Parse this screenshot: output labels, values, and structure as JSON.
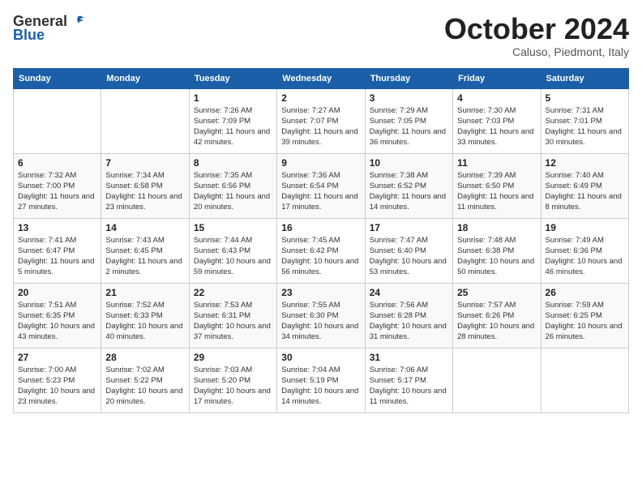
{
  "header": {
    "logo_general": "General",
    "logo_blue": "Blue",
    "month_title": "October 2024",
    "subtitle": "Caluso, Piedmont, Italy"
  },
  "weekdays": [
    "Sunday",
    "Monday",
    "Tuesday",
    "Wednesday",
    "Thursday",
    "Friday",
    "Saturday"
  ],
  "weeks": [
    [
      {
        "day": "",
        "info": ""
      },
      {
        "day": "",
        "info": ""
      },
      {
        "day": "1",
        "info": "Sunrise: 7:26 AM\nSunset: 7:09 PM\nDaylight: 11 hours and 42 minutes."
      },
      {
        "day": "2",
        "info": "Sunrise: 7:27 AM\nSunset: 7:07 PM\nDaylight: 11 hours and 39 minutes."
      },
      {
        "day": "3",
        "info": "Sunrise: 7:29 AM\nSunset: 7:05 PM\nDaylight: 11 hours and 36 minutes."
      },
      {
        "day": "4",
        "info": "Sunrise: 7:30 AM\nSunset: 7:03 PM\nDaylight: 11 hours and 33 minutes."
      },
      {
        "day": "5",
        "info": "Sunrise: 7:31 AM\nSunset: 7:01 PM\nDaylight: 11 hours and 30 minutes."
      }
    ],
    [
      {
        "day": "6",
        "info": "Sunrise: 7:32 AM\nSunset: 7:00 PM\nDaylight: 11 hours and 27 minutes."
      },
      {
        "day": "7",
        "info": "Sunrise: 7:34 AM\nSunset: 6:58 PM\nDaylight: 11 hours and 23 minutes."
      },
      {
        "day": "8",
        "info": "Sunrise: 7:35 AM\nSunset: 6:56 PM\nDaylight: 11 hours and 20 minutes."
      },
      {
        "day": "9",
        "info": "Sunrise: 7:36 AM\nSunset: 6:54 PM\nDaylight: 11 hours and 17 minutes."
      },
      {
        "day": "10",
        "info": "Sunrise: 7:38 AM\nSunset: 6:52 PM\nDaylight: 11 hours and 14 minutes."
      },
      {
        "day": "11",
        "info": "Sunrise: 7:39 AM\nSunset: 6:50 PM\nDaylight: 11 hours and 11 minutes."
      },
      {
        "day": "12",
        "info": "Sunrise: 7:40 AM\nSunset: 6:49 PM\nDaylight: 11 hours and 8 minutes."
      }
    ],
    [
      {
        "day": "13",
        "info": "Sunrise: 7:41 AM\nSunset: 6:47 PM\nDaylight: 11 hours and 5 minutes."
      },
      {
        "day": "14",
        "info": "Sunrise: 7:43 AM\nSunset: 6:45 PM\nDaylight: 11 hours and 2 minutes."
      },
      {
        "day": "15",
        "info": "Sunrise: 7:44 AM\nSunset: 6:43 PM\nDaylight: 10 hours and 59 minutes."
      },
      {
        "day": "16",
        "info": "Sunrise: 7:45 AM\nSunset: 6:42 PM\nDaylight: 10 hours and 56 minutes."
      },
      {
        "day": "17",
        "info": "Sunrise: 7:47 AM\nSunset: 6:40 PM\nDaylight: 10 hours and 53 minutes."
      },
      {
        "day": "18",
        "info": "Sunrise: 7:48 AM\nSunset: 6:38 PM\nDaylight: 10 hours and 50 minutes."
      },
      {
        "day": "19",
        "info": "Sunrise: 7:49 AM\nSunset: 6:36 PM\nDaylight: 10 hours and 46 minutes."
      }
    ],
    [
      {
        "day": "20",
        "info": "Sunrise: 7:51 AM\nSunset: 6:35 PM\nDaylight: 10 hours and 43 minutes."
      },
      {
        "day": "21",
        "info": "Sunrise: 7:52 AM\nSunset: 6:33 PM\nDaylight: 10 hours and 40 minutes."
      },
      {
        "day": "22",
        "info": "Sunrise: 7:53 AM\nSunset: 6:31 PM\nDaylight: 10 hours and 37 minutes."
      },
      {
        "day": "23",
        "info": "Sunrise: 7:55 AM\nSunset: 6:30 PM\nDaylight: 10 hours and 34 minutes."
      },
      {
        "day": "24",
        "info": "Sunrise: 7:56 AM\nSunset: 6:28 PM\nDaylight: 10 hours and 31 minutes."
      },
      {
        "day": "25",
        "info": "Sunrise: 7:57 AM\nSunset: 6:26 PM\nDaylight: 10 hours and 28 minutes."
      },
      {
        "day": "26",
        "info": "Sunrise: 7:59 AM\nSunset: 6:25 PM\nDaylight: 10 hours and 26 minutes."
      }
    ],
    [
      {
        "day": "27",
        "info": "Sunrise: 7:00 AM\nSunset: 5:23 PM\nDaylight: 10 hours and 23 minutes."
      },
      {
        "day": "28",
        "info": "Sunrise: 7:02 AM\nSunset: 5:22 PM\nDaylight: 10 hours and 20 minutes."
      },
      {
        "day": "29",
        "info": "Sunrise: 7:03 AM\nSunset: 5:20 PM\nDaylight: 10 hours and 17 minutes."
      },
      {
        "day": "30",
        "info": "Sunrise: 7:04 AM\nSunset: 5:19 PM\nDaylight: 10 hours and 14 minutes."
      },
      {
        "day": "31",
        "info": "Sunrise: 7:06 AM\nSunset: 5:17 PM\nDaylight: 10 hours and 11 minutes."
      },
      {
        "day": "",
        "info": ""
      },
      {
        "day": "",
        "info": ""
      }
    ]
  ]
}
